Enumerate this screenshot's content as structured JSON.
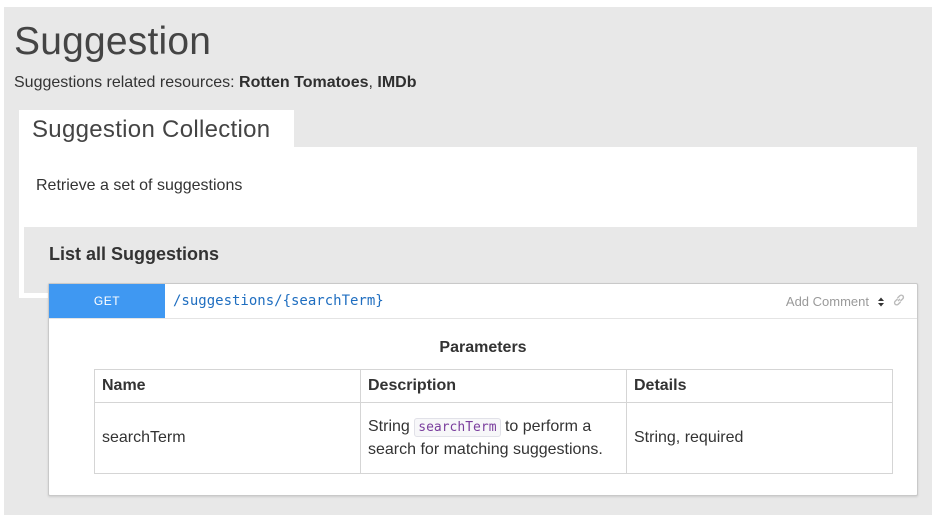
{
  "page": {
    "title": "Suggestion",
    "resources_prefix": "Suggestions related resources: ",
    "resources": [
      "Rotten Tomatoes",
      "IMDb"
    ],
    "resources_separator": ", "
  },
  "collection": {
    "tab_label": "Suggestion Collection",
    "description": "Retrieve a set of suggestions"
  },
  "action": {
    "title": "List all Suggestions",
    "method": "GET",
    "path": "/suggestions/{searchTerm}",
    "add_comment": "Add Comment",
    "icons": [
      "sort-icon",
      "link-icon"
    ]
  },
  "parameters": {
    "caption": "Parameters",
    "columns": [
      "Name",
      "Description",
      "Details"
    ],
    "rows": [
      {
        "name": "searchTerm",
        "desc_before": "String ",
        "desc_code": "searchTerm",
        "desc_after": " to perform a search for matching suggestions.",
        "details": "String, required"
      }
    ]
  },
  "colors": {
    "method_bg": "#3f98f2",
    "path_text": "#1f6ec0",
    "panel_bg": "#e8e8e8",
    "code_text": "#7a3e9d"
  }
}
